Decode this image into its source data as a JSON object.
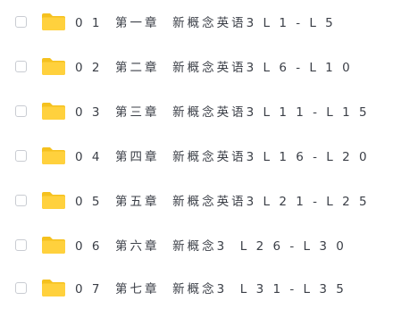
{
  "files": [
    {
      "name": "0 1  第一章  新概念英语3 L 1 - L 5"
    },
    {
      "name": "0 2  第二章  新概念英语3 L 6 - L 1 0"
    },
    {
      "name": "0 3  第三章  新概念英语3 L 1 1 - L 1 5"
    },
    {
      "name": "0 4  第四章  新概念英语3 L 1 6 - L 2 0"
    },
    {
      "name": "0 5  第五章  新概念英语3 L 2 1 - L 2 5"
    },
    {
      "name": "0 6  第六章  新概念3  L 2 6 - L 3 0"
    },
    {
      "name": "0 7  第七章  新概念3  L 3 1 - L 3 5"
    }
  ],
  "colors": {
    "folder": "#FFD13D",
    "folder_tab": "#F5C11E",
    "text": "#3b3f47",
    "checkbox_border": "#c9ccd2"
  },
  "icons": {
    "folder": "folder-icon",
    "checkbox": "checkbox-icon"
  }
}
